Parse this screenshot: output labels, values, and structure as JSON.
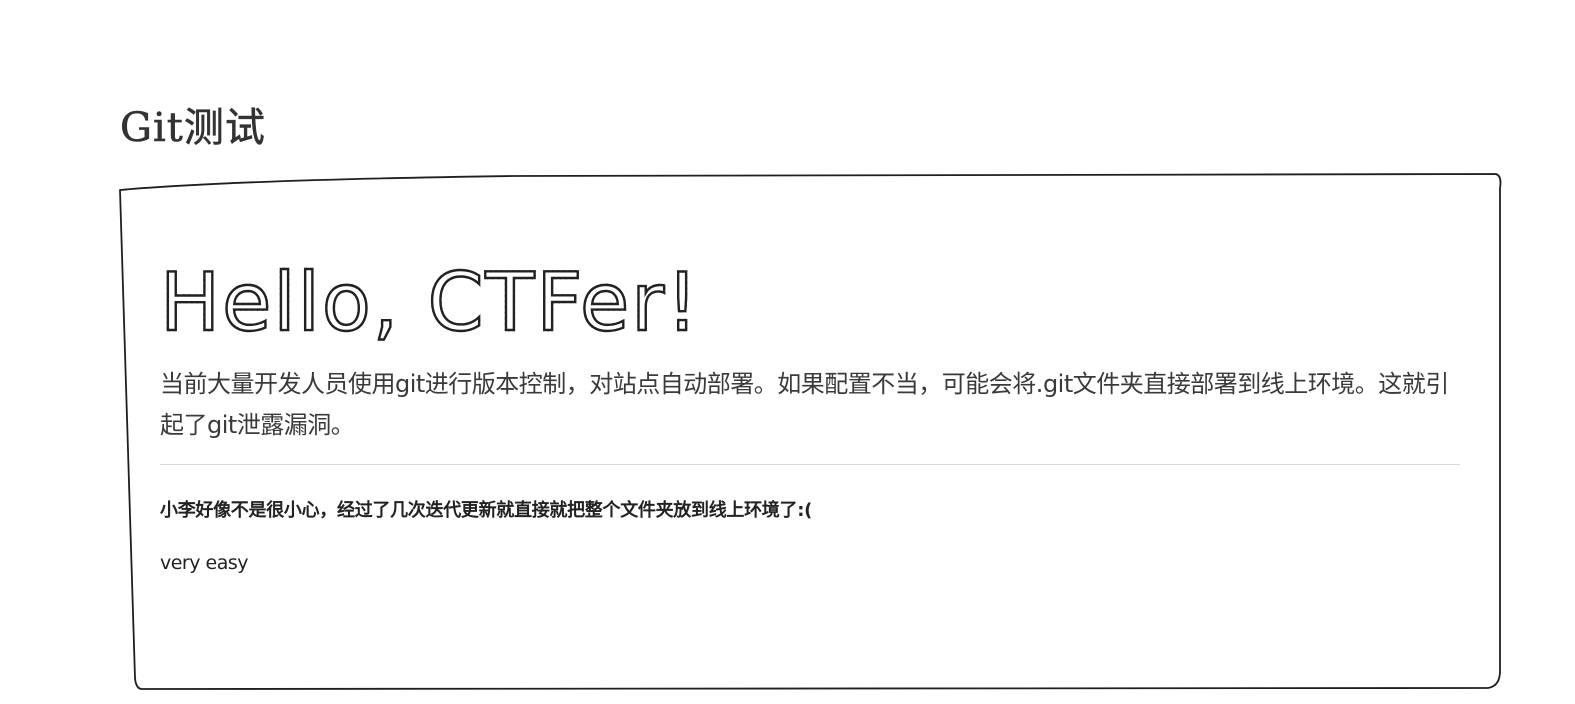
{
  "page": {
    "heading": "Git测试"
  },
  "hero": {
    "title": "Hello, CTFer!",
    "intro": "当前大量开发人员使用git进行版本控制，对站点自动部署。如果配置不当，可能会将.git文件夹直接部署到线上环境。这就引起了git泄露漏洞。",
    "hint": "小李好像不是很小心，经过了几次迭代更新就直接就把整个文件夹放到线上环境了:(",
    "note": "very easy"
  }
}
